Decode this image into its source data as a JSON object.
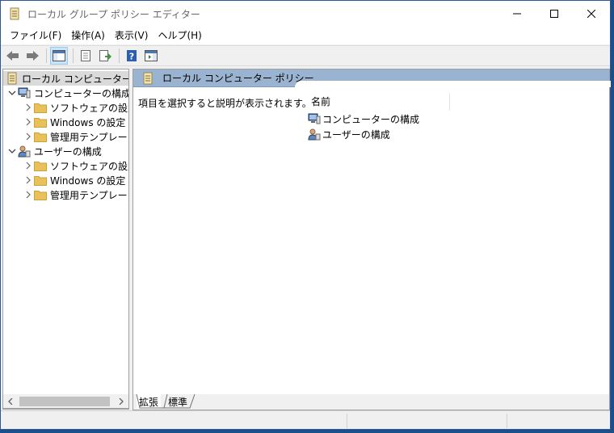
{
  "window": {
    "title": "ローカル グループ ポリシー エディター"
  },
  "window_buttons": {
    "minimize": "─",
    "maximize": "☐",
    "close": "✕"
  },
  "menu": [
    "ファイル(F)",
    "操作(A)",
    "表示(V)",
    "ヘルプ(H)"
  ],
  "toolbar": {
    "back_icon": "arrow-left-icon",
    "forward_icon": "arrow-right-icon",
    "show_tree_icon": "console-tree-icon",
    "properties_icon": "properties-icon",
    "export_icon": "export-list-icon",
    "help_icon": "help-icon",
    "action_pane_icon": "action-pane-icon"
  },
  "tree": {
    "root": "ローカル コンピューター ポリシー",
    "nodes": [
      {
        "label": "コンピューターの構成",
        "children": [
          "ソフトウェアの設定",
          "Windows の設定",
          "管理用テンプレート"
        ]
      },
      {
        "label": "ユーザーの構成",
        "children": [
          "ソフトウェアの設定",
          "Windows の設定",
          "管理用テンプレート"
        ]
      }
    ]
  },
  "right": {
    "header_title": "ローカル コンピューター ポリシー",
    "description": "項目を選択すると説明が表示されます。",
    "column_name": "名前",
    "items": [
      "コンピューターの構成",
      "ユーザーの構成"
    ]
  },
  "tabs": [
    "拡張",
    "標準"
  ],
  "colors": {
    "accent": "#2b579a",
    "header_band": "#9ab3d0",
    "folder": "#e8c15a",
    "selection": "#dadada"
  }
}
